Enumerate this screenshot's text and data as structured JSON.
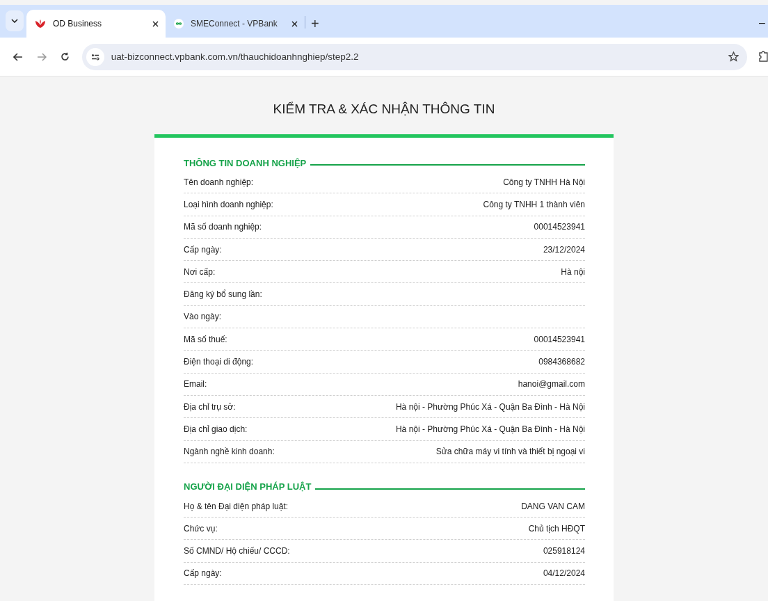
{
  "browser": {
    "tabs": [
      {
        "title": "OD Business",
        "selected": true
      },
      {
        "title": "SMEConnect - VPBank",
        "selected": false
      }
    ],
    "new_tab": "+",
    "minimize": "–",
    "url": "uat-bizconnect.vpbank.com.vn/thauchidoanhnghiep/step2.2"
  },
  "page": {
    "title": "KIỂM TRA & XÁC NHẬN THÔNG TIN",
    "sections": [
      {
        "heading": "THÔNG TIN DOANH NGHIỆP",
        "rows": [
          {
            "label": "Tên doanh nghiệp:",
            "value": "Công ty TNHH Hà Nội"
          },
          {
            "label": "Loại hình doanh nghiệp:",
            "value": "Công ty TNHH 1 thành viên"
          },
          {
            "label": "Mã số doanh nghiệp:",
            "value": "00014523941"
          },
          {
            "label": "Cấp ngày:",
            "value": "23/12/2024"
          },
          {
            "label": "Nơi cấp:",
            "value": "Hà nội"
          },
          {
            "label": "Đăng ký bổ sung lần:"
          },
          {
            "label": "Vào ngày:"
          },
          {
            "label": "Mã số thuế:",
            "value": "00014523941"
          },
          {
            "label": "Điện thoại di động:",
            "value": "0984368682"
          },
          {
            "label": "Email:",
            "value": "hanoi@gmail.com"
          },
          {
            "label": "Địa chỉ trụ sở:",
            "value": "Hà nội - Phường Phúc Xá - Quận Ba Đình - Hà Nội"
          },
          {
            "label": "Địa chỉ giao dịch:",
            "value": "Hà nội - Phường Phúc Xá - Quận Ba Đình - Hà Nội"
          },
          {
            "label": "Ngành nghề kinh doanh:",
            "value": "Sửa chữa máy vi tính và thiết bị ngoại vi"
          }
        ]
      },
      {
        "heading": "NGƯỜI ĐẠI DIỆN PHÁP LUẬT",
        "rows": [
          {
            "label": "Họ & tên Đại diện pháp luật:",
            "value": "DANG VAN CAM"
          },
          {
            "label": "Chức vụ:",
            "value": "Chủ tịch HĐQT"
          },
          {
            "label": "Số CMND/ Hộ chiếu/ CCCD:",
            "value": "025918124"
          },
          {
            "label": "Cấp ngày:",
            "value": "04/12/2024"
          }
        ]
      }
    ]
  }
}
